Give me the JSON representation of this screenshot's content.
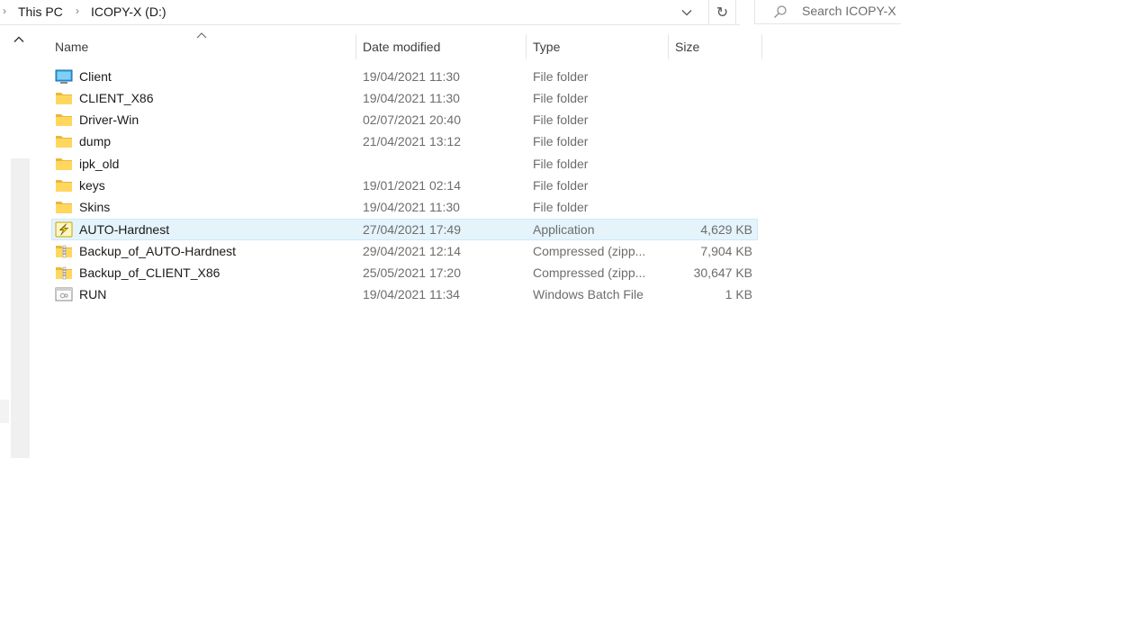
{
  "address_bar": {
    "breadcrumbs": [
      {
        "label": "This PC"
      },
      {
        "label": "ICOPY-X (D:)"
      }
    ],
    "dropdown_icon": "chevron-down-icon",
    "refresh_icon": "refresh-icon",
    "refresh_glyph": "↻"
  },
  "search": {
    "placeholder": "Search ICOPY-X",
    "icon": "search-icon"
  },
  "columns": [
    {
      "key": "name",
      "label": "Name"
    },
    {
      "key": "date",
      "label": "Date modified"
    },
    {
      "key": "type",
      "label": "Type"
    },
    {
      "key": "size",
      "label": "Size"
    }
  ],
  "files": [
    {
      "name": "Client",
      "date": "19/04/2021 11:30",
      "type": "File folder",
      "size": "",
      "icon": "desktop-folder-icon",
      "selected": false
    },
    {
      "name": "CLIENT_X86",
      "date": "19/04/2021 11:30",
      "type": "File folder",
      "size": "",
      "icon": "folder-icon",
      "selected": false
    },
    {
      "name": "Driver-Win",
      "date": "02/07/2021 20:40",
      "type": "File folder",
      "size": "",
      "icon": "folder-icon",
      "selected": false
    },
    {
      "name": "dump",
      "date": "21/04/2021 13:12",
      "type": "File folder",
      "size": "",
      "icon": "folder-icon",
      "selected": false
    },
    {
      "name": "ipk_old",
      "date": "",
      "type": "File folder",
      "size": "",
      "icon": "folder-icon",
      "selected": false
    },
    {
      "name": "keys",
      "date": "19/01/2021 02:14",
      "type": "File folder",
      "size": "",
      "icon": "folder-icon",
      "selected": false
    },
    {
      "name": "Skins",
      "date": "19/04/2021 11:30",
      "type": "File folder",
      "size": "",
      "icon": "folder-icon",
      "selected": false
    },
    {
      "name": "AUTO-Hardnest",
      "date": "27/04/2021 17:49",
      "type": "Application",
      "size": "4,629 KB",
      "icon": "application-icon",
      "selected": true
    },
    {
      "name": "Backup_of_AUTO-Hardnest",
      "date": "29/04/2021 12:14",
      "type": "Compressed (zipp...",
      "size": "7,904 KB",
      "icon": "zip-folder-icon",
      "selected": false
    },
    {
      "name": "Backup_of_CLIENT_X86",
      "date": "25/05/2021 17:20",
      "type": "Compressed (zipp...",
      "size": "30,647 KB",
      "icon": "zip-folder-icon",
      "selected": false
    },
    {
      "name": "RUN",
      "date": "19/04/2021 11:34",
      "type": "Windows Batch File",
      "size": "1 KB",
      "icon": "batch-file-icon",
      "selected": false
    }
  ],
  "colors": {
    "folder": "#ffd75e",
    "selection_bg": "#e5f3fb",
    "selection_border": "#cce8ff",
    "muted_text": "#6d6d6d"
  }
}
